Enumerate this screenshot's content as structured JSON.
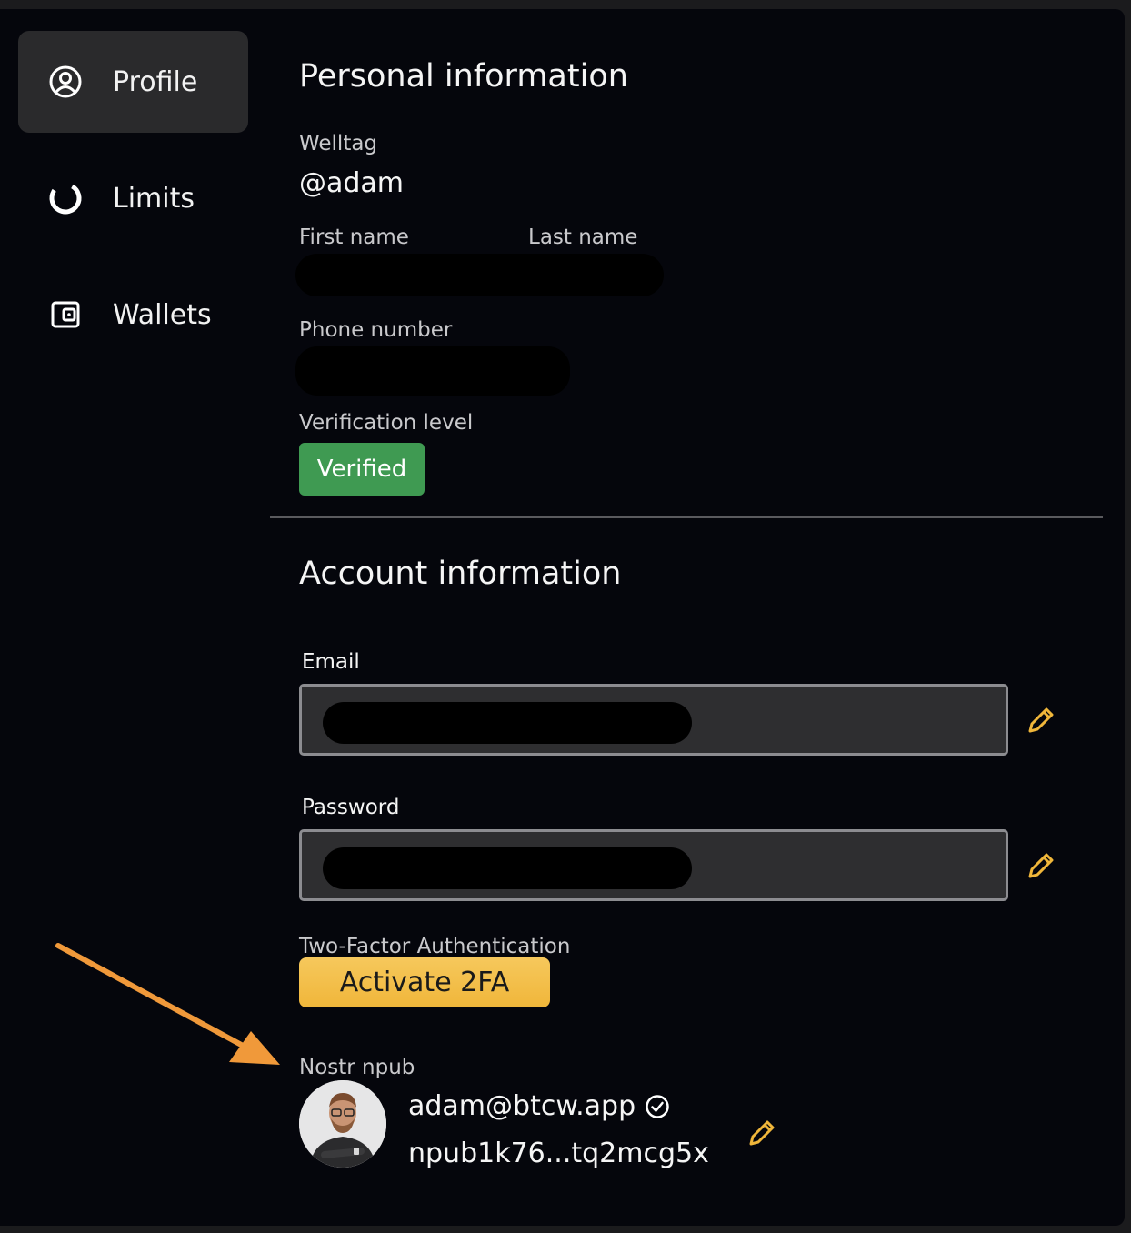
{
  "sidebar": {
    "items": [
      {
        "label": "Profile",
        "icon": "user-circle-icon",
        "active": true
      },
      {
        "label": "Limits",
        "icon": "donut-chart-icon",
        "active": false
      },
      {
        "label": "Wallets",
        "icon": "wallet-icon",
        "active": false
      }
    ]
  },
  "personal": {
    "title": "Personal information",
    "welltag_label": "Welltag",
    "welltag_value": "@adam",
    "first_name_label": "First name",
    "last_name_label": "Last name",
    "phone_label": "Phone number",
    "verification_label": "Verification level",
    "verification_badge": "Verified"
  },
  "account": {
    "title": "Account information",
    "email_label": "Email",
    "password_label": "Password",
    "twofa_label": "Two-Factor Authentication",
    "twofa_button": "Activate 2FA",
    "nostr_label": "Nostr npub",
    "nostr_nip05": "adam@btcw.app",
    "nostr_npub": "npub1k76...tq2mcg5x"
  },
  "colors": {
    "accent": "#f0b63a",
    "verified": "#3f9a52",
    "annotation_arrow": "#f0993a"
  }
}
